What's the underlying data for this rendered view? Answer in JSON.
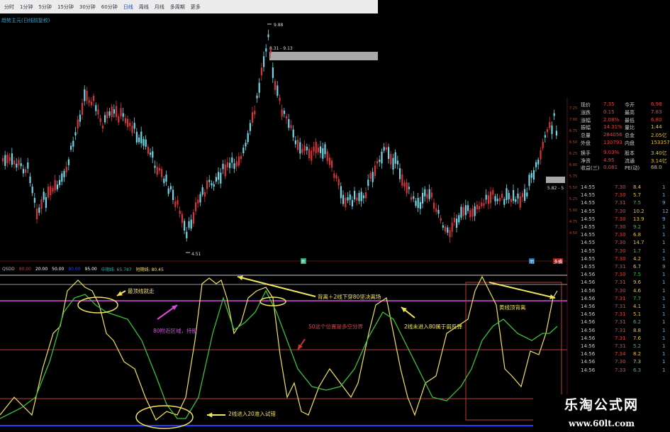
{
  "toolbar": {
    "items": [
      "分时",
      "1分钟",
      "5分钟",
      "15分钟",
      "30分钟",
      "60分钟",
      "日线",
      "周线",
      "月线",
      "多周期",
      "更多"
    ],
    "active": "日线"
  },
  "indicator_title": "趋势主元(日线前复权)",
  "price_labels": {
    "high": "9.88",
    "high_range": "8.31 - 9.13",
    "low": "4.51",
    "right": "5.82 - 5"
  },
  "markers": {
    "m1": "新",
    "m2": "明",
    "m3": "多横"
  },
  "indicator_legend": [
    "QSDD",
    "80.00",
    "20.00",
    "50.00",
    "80.00",
    "95.00",
    "中期线: 65.787",
    "短期线: 80.45"
  ],
  "annotations": {
    "a1": "最顶线就走",
    "a2": "背离＋2线下穿80坚决离场",
    "a3": "80附近区域，持股",
    "a4": "50这个位置是多空分界",
    "a5": "2线未进入80属于弱反弹",
    "a6": "黄线顶背离",
    "a7": "2线进入20准入试错"
  },
  "quote_table": {
    "labels_left": [
      "现价",
      "涨跌",
      "涨幅",
      "振幅",
      "总量",
      "外盘",
      "换手",
      "净资",
      "收益(三)"
    ],
    "values_left": [
      "7.35",
      "0.15",
      "2.08%",
      "14.31%",
      "284056",
      "130793",
      "9.03%",
      "4.95",
      "0.081"
    ],
    "labels_right": [
      "今开",
      "最高",
      "最低",
      "量比",
      "总金",
      "内盘",
      "股本",
      "流通",
      "PE(动)"
    ],
    "values_right": [
      "6.98",
      "7.83",
      "6.80",
      "1.44",
      "2.05亿",
      "153357",
      "3.40亿",
      "3.14亿",
      "68.0"
    ]
  },
  "right_axis": [
    "7.25",
    "7.00",
    "6.75",
    "6.50",
    "6.25",
    "6.00",
    "5.75",
    "5.50",
    "5.25",
    "5.00",
    "4.75",
    "4.50"
  ],
  "trades": [
    [
      "14:55",
      "7.30",
      "8.4",
      "1"
    ],
    [
      "14:55",
      "7.30",
      "5.7",
      "1"
    ],
    [
      "14:55",
      "7.31",
      "7.5",
      "9"
    ],
    [
      "14:55",
      "7.30",
      "10.2",
      "12"
    ],
    [
      "14:55",
      "7.30",
      "13.9",
      "9"
    ],
    [
      "14:55",
      "7.30",
      "9.2",
      "1"
    ],
    [
      "14:55",
      "7.30",
      "6.8",
      "1"
    ],
    [
      "14:55",
      "7.30",
      "14.7",
      "1"
    ],
    [
      "14:55",
      "7.30",
      "1.7",
      "1"
    ],
    [
      "14:55",
      "7.30",
      "4.2",
      "1"
    ],
    [
      "14:55",
      "7.31",
      "6.7",
      "9"
    ],
    [
      "14:56",
      "7.30",
      "7.5",
      "1"
    ],
    [
      "14:56",
      "7.31",
      "9.6",
      "1"
    ],
    [
      "14:56",
      "7.30",
      "4.6",
      "1"
    ],
    [
      "14:56",
      "7.31",
      "7.7",
      "1"
    ],
    [
      "14:56",
      "7.31",
      "4.1",
      "1"
    ],
    [
      "14:56",
      "7.31",
      "5.1",
      "1"
    ],
    [
      "14:56",
      "7.31",
      "6.2",
      "1"
    ],
    [
      "14:56",
      "7.31",
      "8.8",
      "1"
    ],
    [
      "14:56",
      "7.31",
      "7.6",
      "1"
    ],
    [
      "14:56",
      "7.31",
      "5.2",
      "1"
    ],
    [
      "14:56",
      "7.34",
      "8.2",
      "1"
    ],
    [
      "14:56",
      "7.30",
      "7.3",
      "1"
    ],
    [
      "14:56",
      "7.33",
      "6.3",
      "1"
    ]
  ],
  "watermark": {
    "brand": "乐淘公式网",
    "url": "www.60lt.com"
  },
  "colors": {
    "up": "#d9323a",
    "down": "#6fd6e6",
    "yellow": "#f2e45c",
    "green": "#39c23a",
    "magenta": "#d94adf",
    "red_line": "#c03a3a",
    "blue_line": "#2540ff"
  }
}
